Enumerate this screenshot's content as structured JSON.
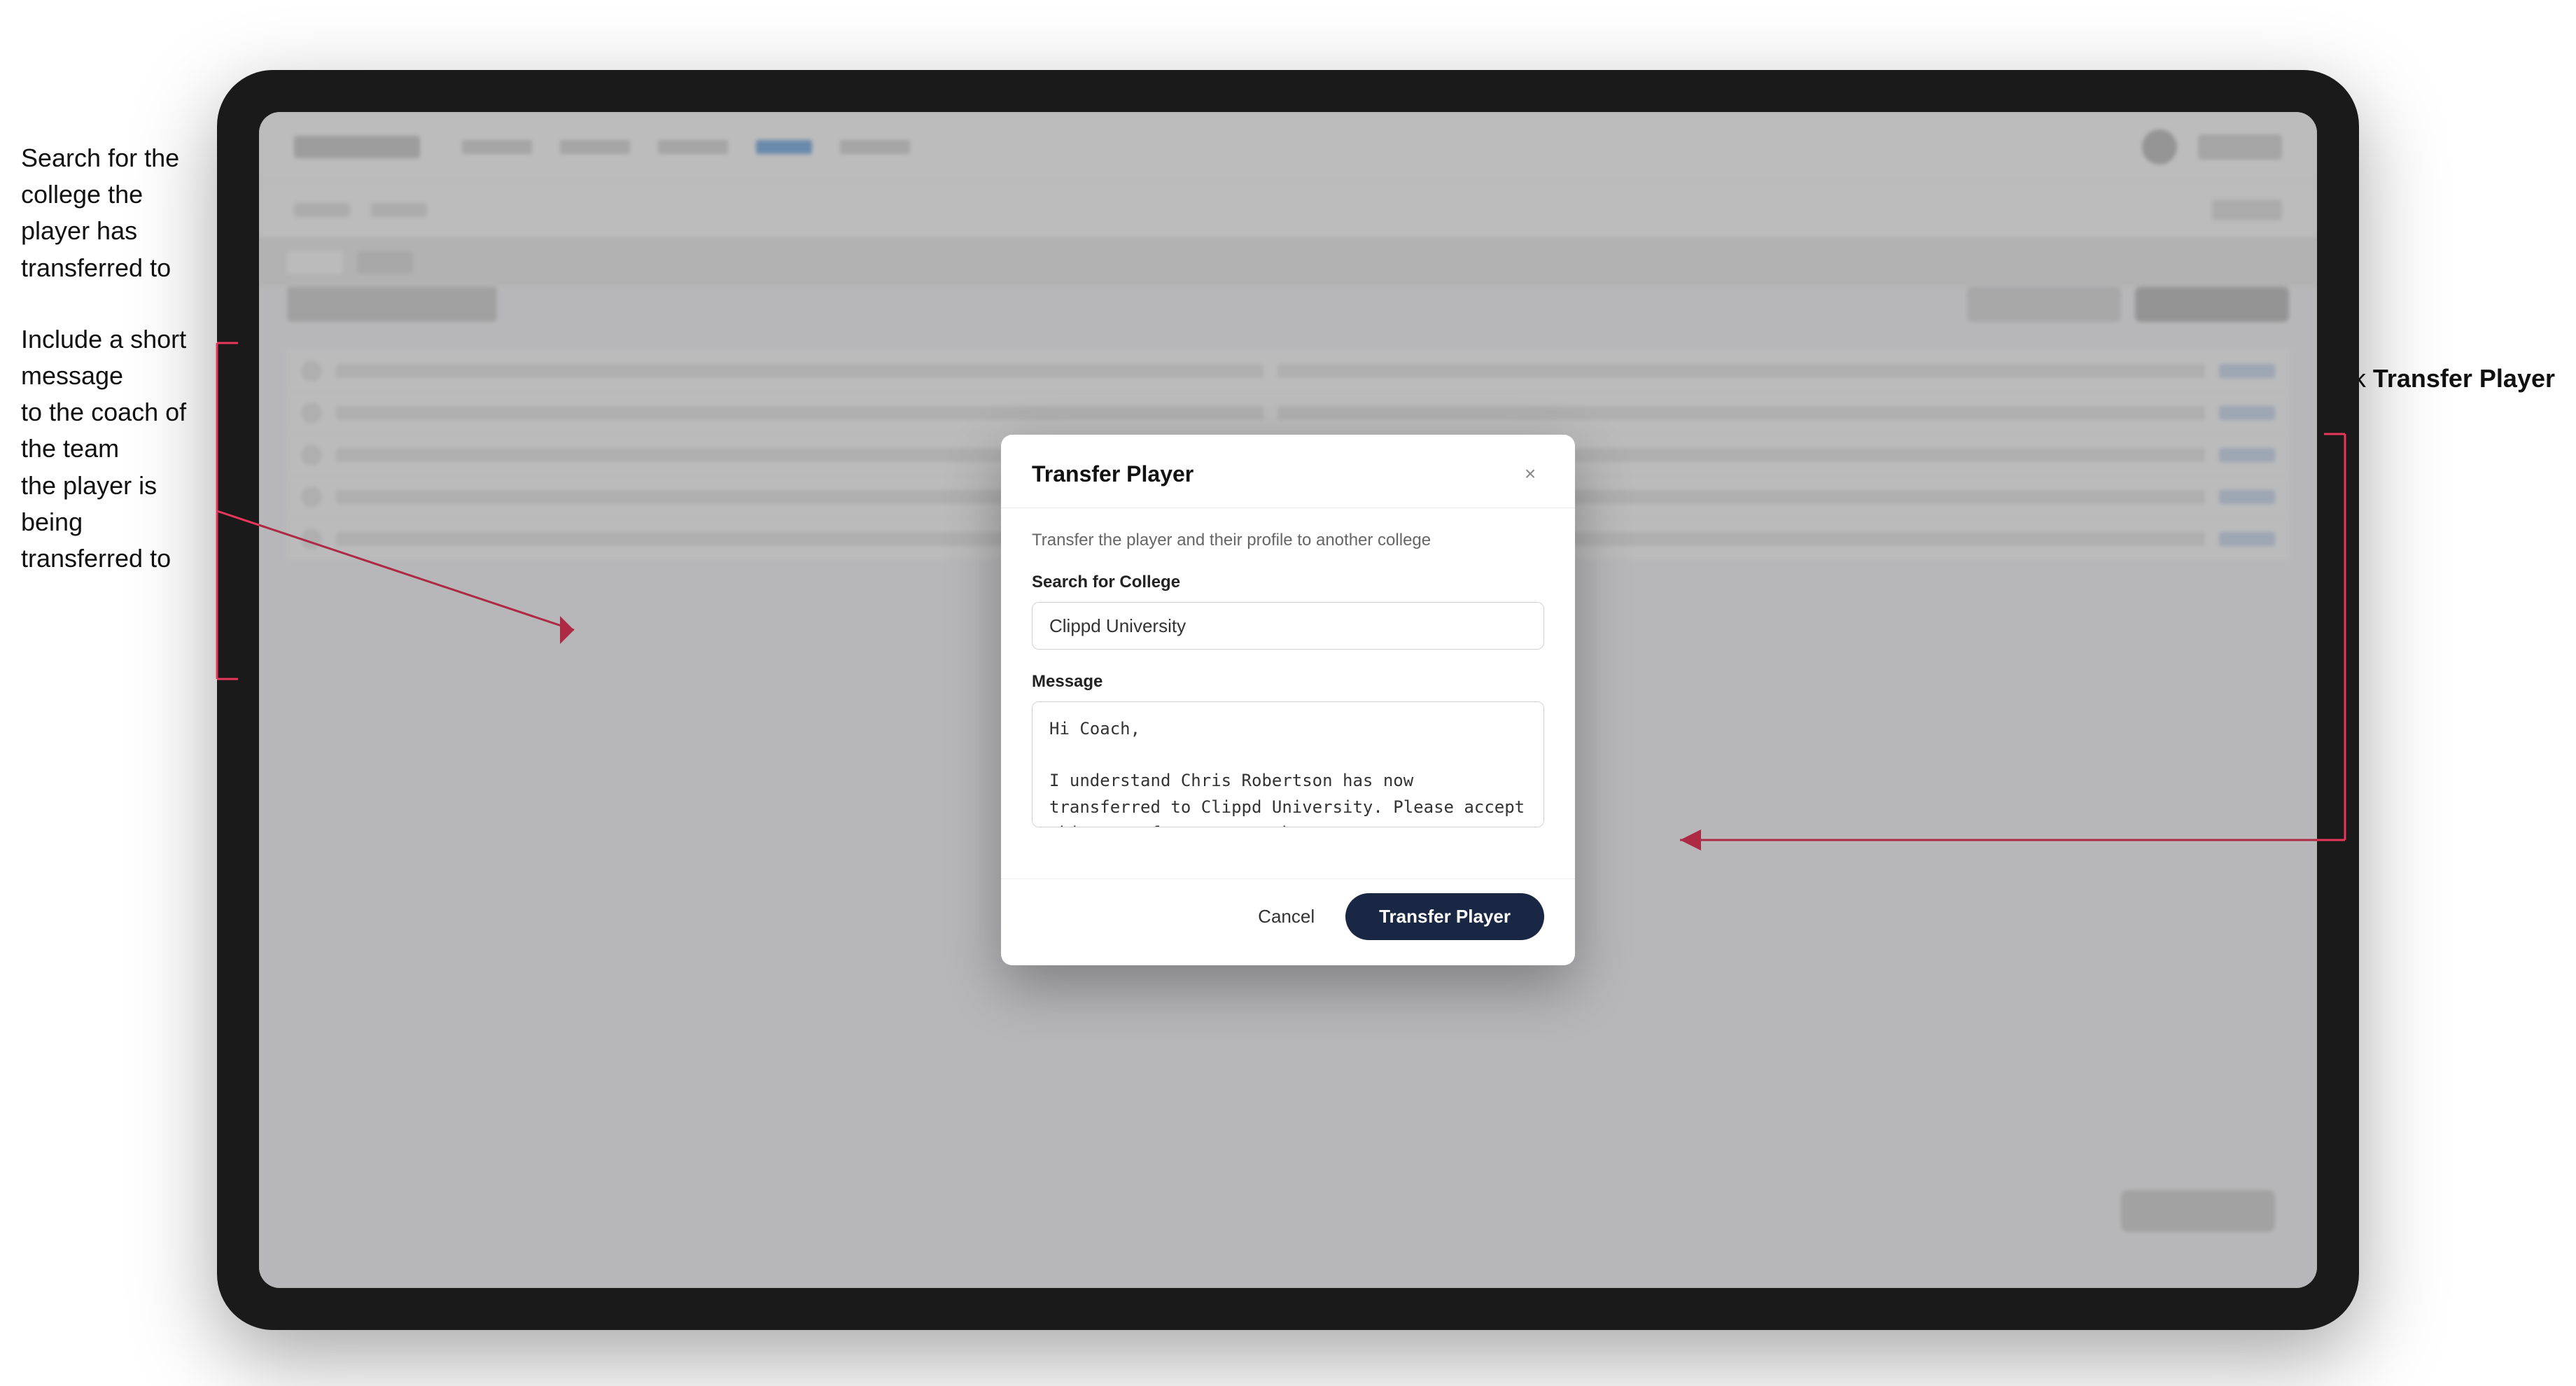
{
  "annotations": {
    "left_top": "Search for the college the player has transferred to",
    "left_bottom": "Include a short message\nto the coach of the team\nthe player is being\ntransferred to",
    "right": "Click",
    "right_bold": "Transfer Player"
  },
  "nav": {
    "logo_alt": "Logo",
    "active_tab": "Roster"
  },
  "page": {
    "title": "Update Roster"
  },
  "modal": {
    "title": "Transfer Player",
    "subtitle": "Transfer the player and their profile to another college",
    "college_label": "Search for College",
    "college_value": "Clippd University",
    "message_label": "Message",
    "message_value": "Hi Coach,\n\nI understand Chris Robertson has now transferred to Clippd University. Please accept this transfer request when you can.",
    "cancel_label": "Cancel",
    "transfer_label": "Transfer Player",
    "close_label": "×"
  }
}
